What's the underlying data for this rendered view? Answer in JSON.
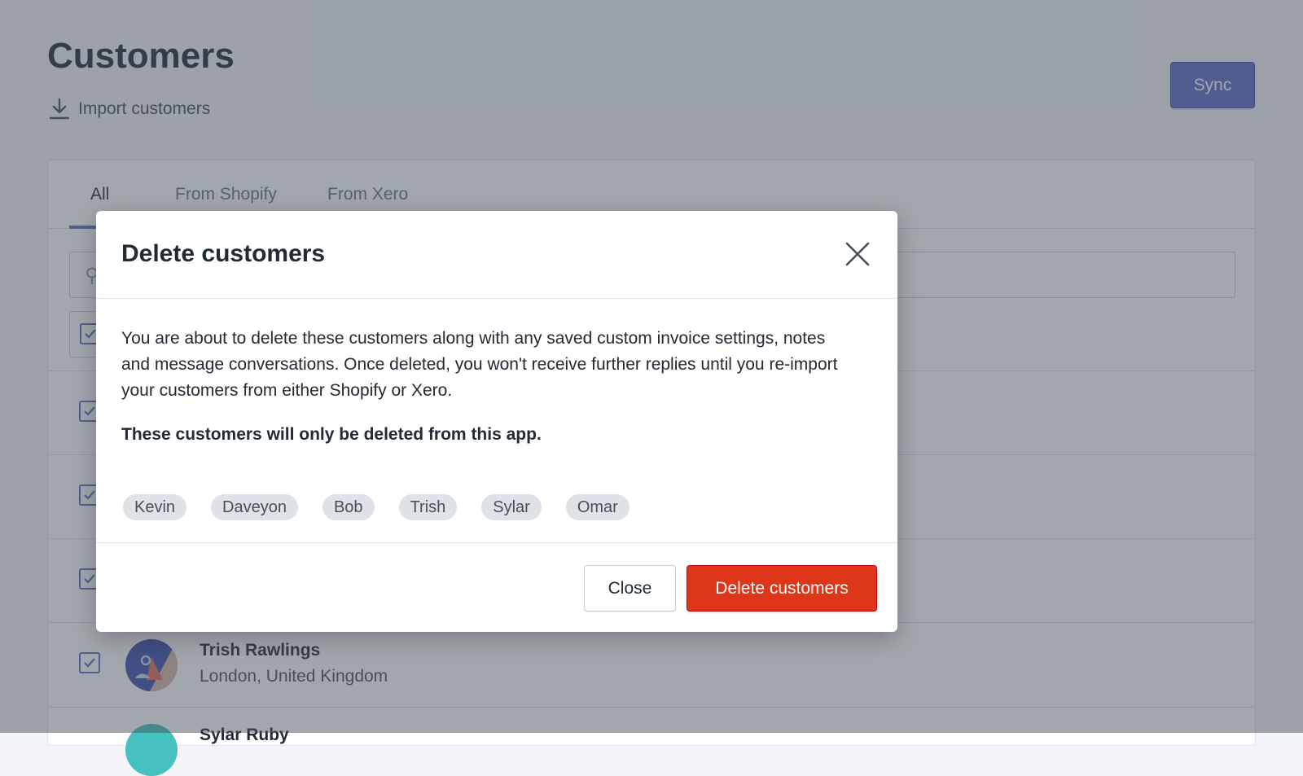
{
  "page": {
    "title": "Customers",
    "import_label": "Import customers",
    "import_icon": "download-icon",
    "sync_label": "Sync"
  },
  "tabs": [
    {
      "label": "All",
      "active": true
    },
    {
      "label": "From Shopify",
      "active": false
    },
    {
      "label": "From Xero",
      "active": false
    }
  ],
  "customers": [
    {
      "name": "Trish Rawlings",
      "location": "London, United Kingdom",
      "checked": true
    },
    {
      "name": "Sylar Ruby",
      "location": "",
      "checked": true
    }
  ],
  "modal": {
    "title": "Delete customers",
    "close_icon": "close-icon",
    "body": "You are about to delete these customers along with any saved custom invoice settings, notes and message conversations. Once deleted, you won't receive further replies until you re-import your customers from either Shopify or Xero.",
    "bold_note": "These customers will only be deleted from this app.",
    "tags": [
      "Kevin",
      "Daveyon",
      "Bob",
      "Trish",
      "Sylar",
      "Omar"
    ],
    "close_label": "Close",
    "delete_label": "Delete customers"
  },
  "colors": {
    "accent": "#5c6ac4",
    "danger": "#de3618",
    "overlay": "rgba(69,79,91,0.5)"
  }
}
